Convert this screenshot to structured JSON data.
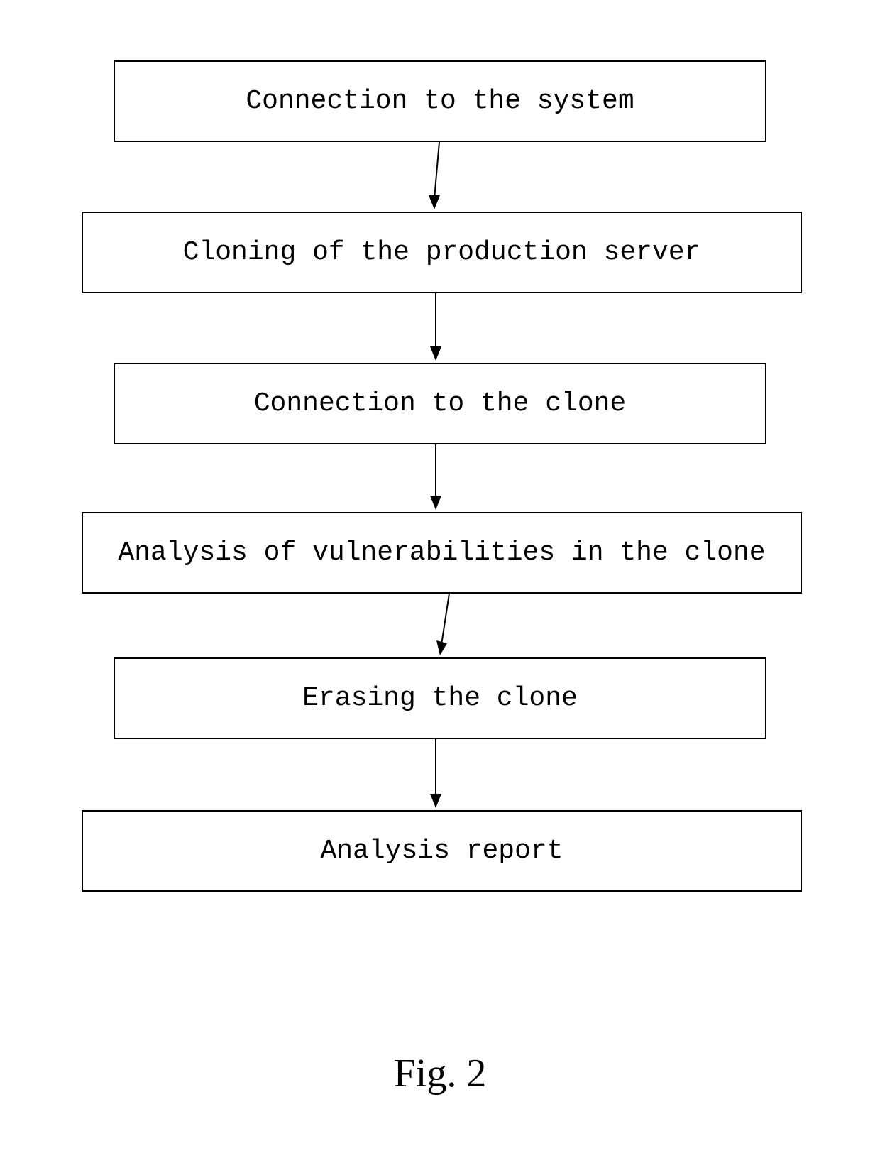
{
  "steps": {
    "s1": "Connection to the system",
    "s2": "Cloning of the production server",
    "s3": "Connection to the clone",
    "s4": "Analysis of vulnerabilities in the clone",
    "s5": "Erasing the clone",
    "s6": "Analysis report"
  },
  "figure_label": "Fig. 2"
}
